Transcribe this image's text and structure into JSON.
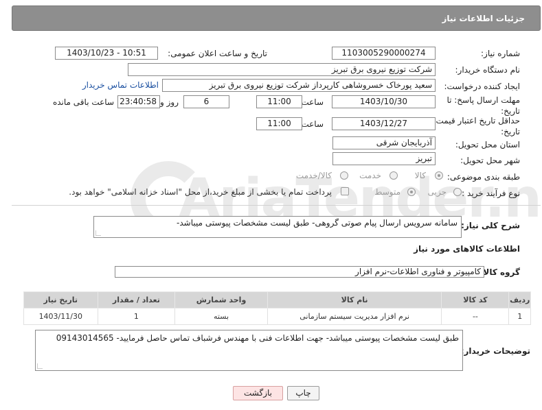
{
  "header": {
    "title": "جزئیات اطلاعات نیاز"
  },
  "fields": {
    "need_number_label": "شماره نیاز:",
    "need_number": "1103005290000274",
    "announce_label": "تاریخ و ساعت اعلان عمومی:",
    "announce_value": "1403/10/23 - 10:51",
    "buyer_org_label": "نام دستگاه خریدار:",
    "buyer_org": "شرکت توزیع نیروی برق تبریز",
    "requester_label": "ایجاد کننده درخواست:",
    "requester": "سعید پورخاک خسروشاهی کارپرداز شرکت توزیع نیروی برق تبریز",
    "buyer_contact_link": "اطلاعات تماس خریدار",
    "reply_deadline_label": "مهلت ارسال پاسخ: تا تاریخ:",
    "reply_date": "1403/10/30",
    "time_label": "ساعت",
    "reply_time": "11:00",
    "days_value": "6",
    "days_label": "روز و",
    "remaining_time": "23:40:58",
    "remaining_label": "ساعت باقی مانده",
    "price_valid_label": "حداقل تاریخ اعتبار قیمت: تا تاریخ:",
    "price_valid_date": "1403/12/27",
    "price_valid_time": "11:00",
    "province_label": "استان محل تحویل:",
    "province": "آذربایجان شرقی",
    "city_label": "شهر محل تحویل:",
    "city": "تبریز",
    "category_label": "طبقه بندی موضوعی:",
    "category_options": [
      "کالا",
      "خدمت",
      "کالا/خدمت"
    ],
    "process_label": "نوع فرآیند خرید :",
    "process_options": [
      "جزیی",
      "متوسط"
    ],
    "payment_note": "پرداخت تمام یا بخشی از مبلغ خرید،از محل \"اسناد خزانه اسلامی\" خواهد بود."
  },
  "description": {
    "label": "شرح کلی نیاز:",
    "value": "سامانه سرویس ارسال پیام صوتی گروهی- طبق لیست مشخصات پیوستی میباشد-"
  },
  "goods_section": {
    "title": "اطلاعات کالاهای مورد نیاز",
    "group_label": "گروه کالا:",
    "group_value": "کامپیوتر و فناوری اطلاعات-نرم افزار"
  },
  "table": {
    "headers": [
      "ردیف",
      "کد کالا",
      "نام کالا",
      "واحد شمارش",
      "تعداد / مقدار",
      "تاریخ نیاز"
    ],
    "rows": [
      [
        "1",
        "--",
        "نرم افزار مدیریت سیستم سازمانی",
        "بسته",
        "1",
        "1403/11/30"
      ]
    ]
  },
  "buyer_notes": {
    "label": "توضیحات خریدار:",
    "value": "طبق لیست مشخصات پیوستی میباشد- جهت اطلاعات فنی  با مهندس فرشباف تماس حاصل فرمایید- 09143014565"
  },
  "buttons": {
    "print": "چاپ",
    "back": "بازگشت"
  }
}
